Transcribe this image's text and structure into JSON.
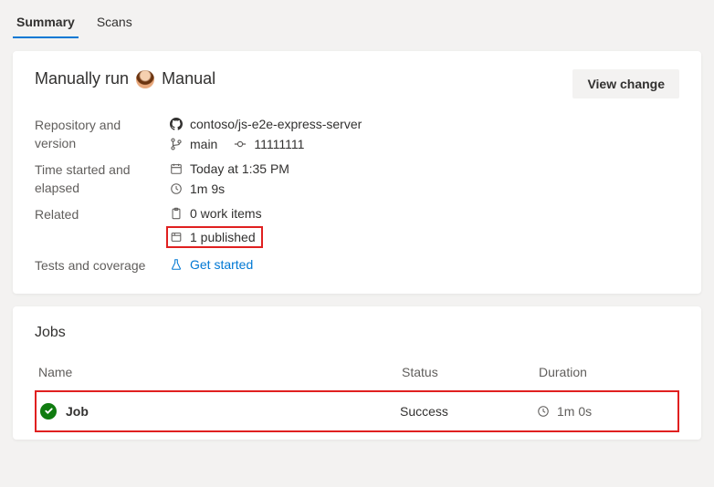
{
  "tabs": {
    "summary": "Summary",
    "scans": "Scans"
  },
  "header": {
    "prefix": "Manually run",
    "trigger": "Manual",
    "view_change": "View change"
  },
  "summary": {
    "repo_label": "Repository and version",
    "repo_name": "contoso/js-e2e-express-server",
    "branch": "main",
    "commit": "11111111",
    "time_label": "Time started and elapsed",
    "time_started": "Today at 1:35 PM",
    "elapsed": "1m 9s",
    "related_label": "Related",
    "work_items": "0 work items",
    "published": "1 published",
    "tests_label": "Tests and coverage",
    "get_started": "Get started"
  },
  "jobs": {
    "title": "Jobs",
    "col_name": "Name",
    "col_status": "Status",
    "col_duration": "Duration",
    "row": {
      "name": "Job",
      "status": "Success",
      "duration": "1m 0s"
    }
  }
}
